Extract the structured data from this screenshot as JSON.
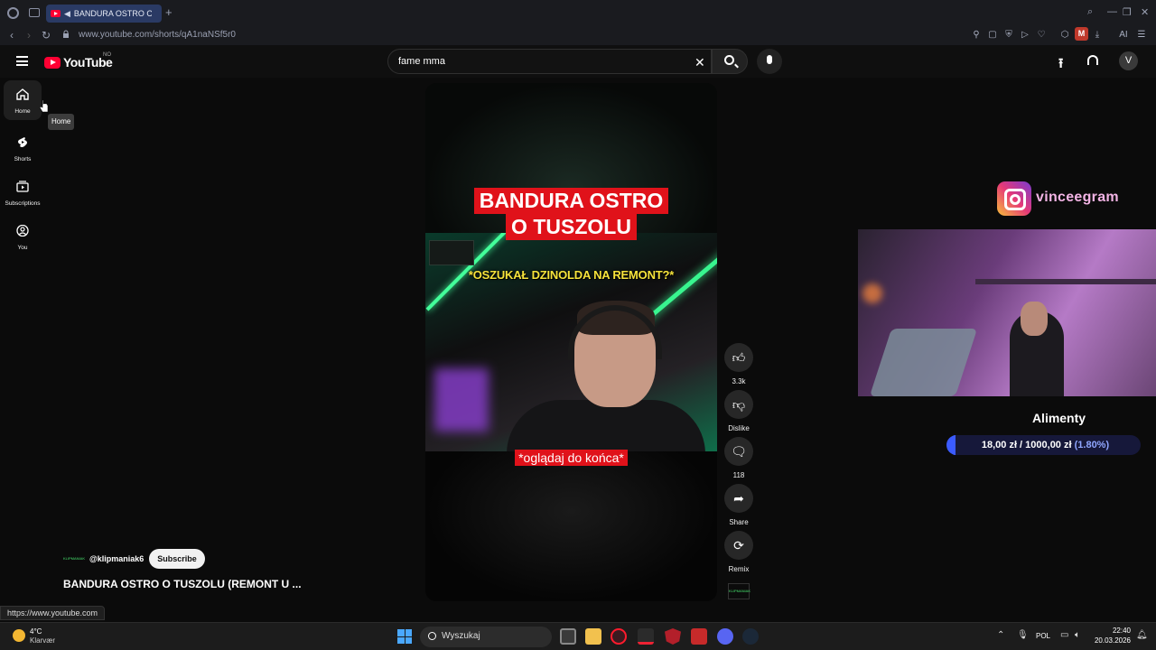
{
  "browser": {
    "tab_title": "BANDURA OSTRO O T",
    "new_tab": "+",
    "url": "www.youtube.com/shorts/qA1naNSf5r0",
    "ext_badge": "M",
    "ai_label": "AI"
  },
  "youtube": {
    "logo_text": "YouTube",
    "region": "NO",
    "search_value": "fame mma",
    "avatar_letter": "V"
  },
  "sidebar": {
    "items": [
      {
        "label": "Home"
      },
      {
        "label": "Shorts"
      },
      {
        "label": "Subscriptions"
      },
      {
        "label": "You"
      }
    ],
    "tooltip": "Home"
  },
  "video": {
    "title_line1": "BANDURA OSTRO",
    "title_line2": "O TUSZOLU",
    "subtitle": "*OSZUKAŁ DZINOLDA NA REMONT?*",
    "bottom_caption": "*oglądaj do końca*",
    "overlay_badge": "KLIPMANIAK"
  },
  "actions": {
    "like_count": "3.3k",
    "dislike_label": "Dislike",
    "comments_count": "118",
    "share_label": "Share",
    "remix_label": "Remix"
  },
  "channel": {
    "handle": "@klipmaniak6",
    "subscribe_label": "Subscribe",
    "video_title": "BANDURA OSTRO O TUSZOLU (REMONT U ..."
  },
  "status_bar": {
    "url": "https://www.youtube.com"
  },
  "stream_overlay": {
    "instagram_handle": "vinceegram",
    "goal_title": "Alimenty",
    "goal_amount": "18,00 zł / 1000,00 zł",
    "goal_percent": "(1.80%)",
    "goal_fraction": 0.018
  },
  "taskbar": {
    "temperature": "4°C",
    "weather": "Klarvær",
    "search_placeholder": "Wyszukaj",
    "language": "POL",
    "time": "22:40",
    "date": "20.03.2026"
  },
  "colors": {
    "youtube_red": "#ff0033",
    "caption_red": "#e0121a",
    "caption_yellow": "#f6e33b",
    "goal_blue": "#3b5bff"
  }
}
